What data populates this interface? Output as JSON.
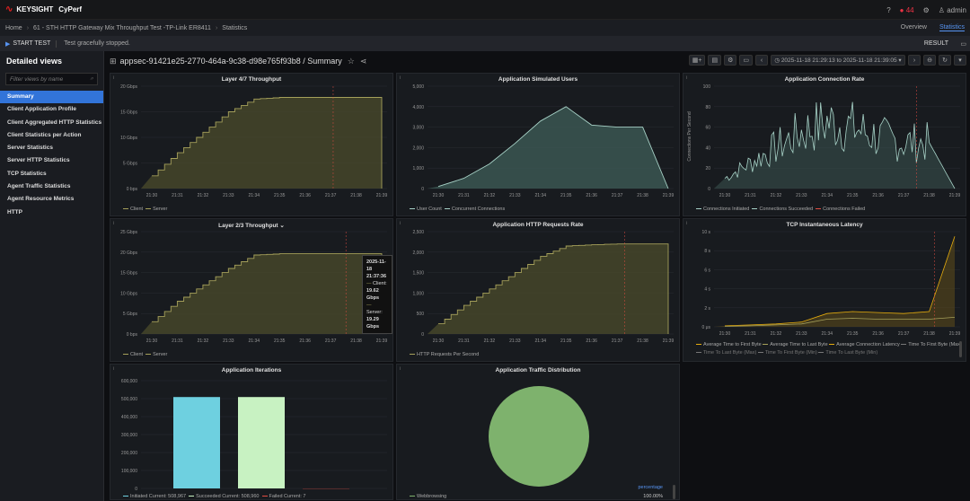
{
  "app": {
    "brand": "KEYSIGHT",
    "product": "CyPerf",
    "alerts": "44",
    "user": "admin"
  },
  "nav": {
    "home": "Home",
    "test": "61 - STH HTTP Gateway Mix Throughput Test -TP-Link ER8411",
    "page": "Statistics",
    "tabs": [
      "Overview",
      "Statistics"
    ]
  },
  "actions": {
    "start": "START TEST",
    "status": "Test gracefully stopped.",
    "result": "RESULT"
  },
  "sidebar": {
    "title": "Detailed views",
    "filter_placeholder": "Filter views by name",
    "items": [
      "Summary",
      "Client Application Profile",
      "Client Aggregated HTTP Statistics",
      "Client Statistics per Action",
      "Server Statistics",
      "Server HTTP Statistics",
      "TCP Statistics",
      "Agent Traffic Statistics",
      "Agent Resource Metrics",
      "HTTP"
    ]
  },
  "dashboard": {
    "title": "appsec-91421e25-2770-464a-9c38-d98e765f93b8 / Summary",
    "time_range": "2025-11-18 21:29:13 to 2025-11-18 21:39:05"
  },
  "xticks": [
    "21:30",
    "21:31",
    "21:32",
    "21:33",
    "21:34",
    "21:35",
    "21:36",
    "21:37",
    "21:38",
    "21:39"
  ],
  "colors": {
    "olive": "#a5a05a",
    "olive_fill": "#4f4f2c",
    "teal": "#a7d2c7",
    "teal_fill": "#3d5a55",
    "blue": "#6ed0e0",
    "lightgreen": "#c8f2c2",
    "green": "#7eb26d",
    "orange": "#e5ac0e",
    "red": "#e24d42"
  },
  "panels": {
    "l47": {
      "title": "Layer 4/7 Throughput",
      "yticks": [
        "0 bps",
        "5 Gbps",
        "10 Gbps",
        "15 Gbps",
        "20 Gbps"
      ],
      "legend": [
        "Client",
        "Server"
      ]
    },
    "sim_users": {
      "title": "Application Simulated Users",
      "yticks": [
        "0",
        "1,000",
        "2,000",
        "3,000",
        "4,000",
        "5,000"
      ],
      "legend": [
        "User Count",
        "Concurrent Connections"
      ]
    },
    "conn_rate": {
      "title": "Application Connection Rate",
      "ylabel": "Connections Per Second",
      "yticks": [
        "0",
        "20",
        "40",
        "60",
        "80",
        "100"
      ],
      "legend": [
        "Connections Initiated",
        "Connections Succeeded",
        "Connections Failed"
      ]
    },
    "l23": {
      "title": "Layer 2/3 Throughput",
      "yticks": [
        "0 bps",
        "5 Gbps",
        "10 Gbps",
        "15 Gbps",
        "20 Gbps",
        "25 Gbps"
      ],
      "legend": [
        "Client",
        "Server"
      ],
      "tooltip": {
        "time": "2025-11-18 21:37:36",
        "client_label": "Client:",
        "client_value": "19.62 Gbps",
        "server_label": "Server:",
        "server_value": "19.29 Gbps"
      }
    },
    "http_rate": {
      "title": "Application HTTP Requests Rate",
      "yticks": [
        "0",
        "500",
        "1,000",
        "1,500",
        "2,000",
        "2,500"
      ],
      "legend": [
        "HTTP Requests Per Second"
      ]
    },
    "tcp_lat": {
      "title": "TCP Instantaneous Latency",
      "yticks": [
        "0 μs",
        "2 s",
        "4 s",
        "6 s",
        "8 s",
        "10 s"
      ],
      "legend": [
        "Average Time to First Byte",
        "Average Time to Last Byte",
        "Average Connection Latency",
        "Time To First Byte (Max)",
        "Time To Last Byte (Max)",
        "Time To First Byte (Min)",
        "Time To Last Byte (Min)"
      ]
    },
    "iterations": {
      "title": "Application Iterations",
      "yticks": [
        "0",
        "100,000",
        "200,000",
        "300,000",
        "400,000",
        "500,000",
        "600,000"
      ],
      "legend": [
        "Initiated Current: 508,967",
        "Succeeded Current: 508,960",
        "Failed Current: 7"
      ]
    },
    "traffic": {
      "title": "Application Traffic Distribution",
      "legend_header": "percentage",
      "legend_name": "Webbrowsing",
      "legend_value": "100.00%"
    }
  },
  "chart_data": [
    {
      "type": "area",
      "title": "Layer 4/7 Throughput",
      "unit": "Gbps",
      "x": [
        "21:30",
        "21:31",
        "21:32",
        "21:33",
        "21:34",
        "21:35",
        "21:36",
        "21:37",
        "21:38",
        "21:39"
      ],
      "series": [
        {
          "name": "Client",
          "values": [
            2.5,
            7,
            11,
            15,
            17.5,
            17.8,
            17.8,
            17.8,
            17.8,
            0
          ]
        },
        {
          "name": "Server",
          "values": [
            2.4,
            6.8,
            10.8,
            14.8,
            17.3,
            17.6,
            17.6,
            17.6,
            17.6,
            0
          ]
        }
      ],
      "ylim": [
        0,
        20
      ]
    },
    {
      "type": "area",
      "title": "Application Simulated Users",
      "x": [
        "21:30",
        "21:31",
        "21:32",
        "21:33",
        "21:34",
        "21:35",
        "21:36",
        "21:37",
        "21:38",
        "21:39"
      ],
      "series": [
        {
          "name": "User Count",
          "values": [
            100,
            500,
            1200,
            2200,
            3300,
            4000,
            3100,
            3000,
            3000,
            0
          ]
        }
      ],
      "ylim": [
        0,
        5000
      ]
    },
    {
      "type": "line",
      "title": "Application Connection Rate",
      "x": [
        "21:30",
        "21:31",
        "21:32",
        "21:33",
        "21:34",
        "21:35",
        "21:36",
        "21:37",
        "21:38",
        "21:39"
      ],
      "series": [
        {
          "name": "Connections Succeeded",
          "values": [
            10,
            25,
            40,
            55,
            65,
            60,
            50,
            45,
            45,
            0
          ]
        }
      ],
      "ylim": [
        0,
        100
      ]
    },
    {
      "type": "area",
      "title": "Layer 2/3 Throughput",
      "unit": "Gbps",
      "x": [
        "21:30",
        "21:31",
        "21:32",
        "21:33",
        "21:34",
        "21:35",
        "21:36",
        "21:37",
        "21:38",
        "21:39"
      ],
      "series": [
        {
          "name": "Client",
          "values": [
            3,
            8,
            12,
            16,
            19.3,
            19.6,
            19.6,
            19.6,
            19.6,
            0
          ]
        },
        {
          "name": "Server",
          "values": [
            2.9,
            7.8,
            11.8,
            15.7,
            19,
            19.3,
            19.3,
            19.3,
            19.3,
            0
          ]
        }
      ],
      "ylim": [
        0,
        25
      ]
    },
    {
      "type": "area",
      "title": "Application HTTP Requests Rate",
      "x": [
        "21:30",
        "21:31",
        "21:32",
        "21:33",
        "21:34",
        "21:35",
        "21:36",
        "21:37",
        "21:38",
        "21:39"
      ],
      "series": [
        {
          "name": "HTTP Requests Per Second",
          "values": [
            250,
            700,
            1100,
            1500,
            1900,
            2150,
            2180,
            2200,
            2200,
            0
          ]
        }
      ],
      "ylim": [
        0,
        2500
      ]
    },
    {
      "type": "line",
      "title": "TCP Instantaneous Latency",
      "unit": "s",
      "x": [
        "21:30",
        "21:31",
        "21:32",
        "21:33",
        "21:34",
        "21:35",
        "21:36",
        "21:37",
        "21:38",
        "21:39"
      ],
      "series": [
        {
          "name": "Time To First Byte (Max)",
          "values": [
            0.1,
            0.2,
            0.3,
            0.5,
            1.4,
            1.6,
            1.5,
            1.4,
            1.6,
            9.5
          ]
        },
        {
          "name": "Average Time to First Byte",
          "values": [
            0.05,
            0.1,
            0.2,
            0.3,
            0.8,
            0.9,
            0.8,
            0.8,
            0.8,
            1
          ]
        }
      ],
      "ylim": [
        0,
        10
      ]
    },
    {
      "type": "bar",
      "title": "Application Iterations",
      "categories": [
        "Initiated",
        "Succeeded",
        "Failed"
      ],
      "values": [
        508967,
        508960,
        7
      ],
      "ylim": [
        0,
        600000
      ]
    },
    {
      "type": "pie",
      "title": "Application Traffic Distribution",
      "categories": [
        "Webbrowsing"
      ],
      "values": [
        100
      ]
    }
  ]
}
